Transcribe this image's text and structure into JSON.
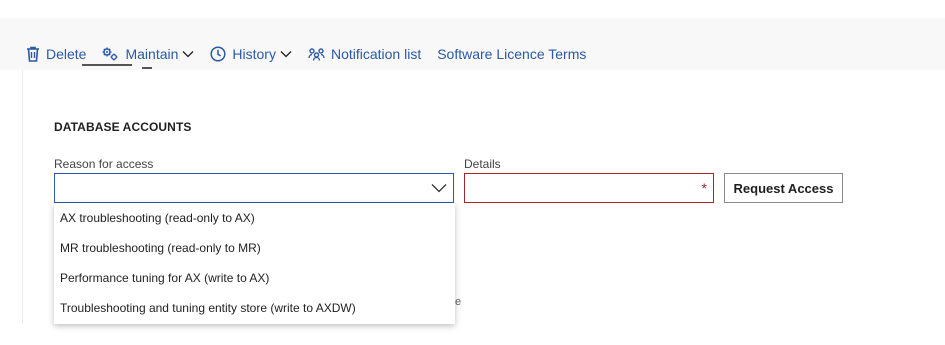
{
  "colors": {
    "accent": "#2b59a6",
    "error": "#a4262c"
  },
  "toolbar": {
    "items": [
      {
        "label": "Delete",
        "icon": "trash-icon"
      },
      {
        "label": "Maintain",
        "icon": "gears-icon",
        "has_menu": true
      },
      {
        "label": "History",
        "icon": "clock-icon",
        "has_menu": true
      },
      {
        "label": "Notification list",
        "icon": "people-network-icon"
      },
      {
        "label": "Software Licence Terms"
      }
    ]
  },
  "section": {
    "title": "DATABASE ACCOUNTS"
  },
  "form": {
    "reason_label": "Reason for access",
    "reason_value": "",
    "details_label": "Details",
    "details_value": "",
    "required_mark": "*",
    "request_button": "Request Access"
  },
  "dropdown": {
    "options": [
      "AX troubleshooting (read-only to AX)",
      "MR troubleshooting (read-only to MR)",
      "Performance tuning for AX (write to AX)",
      "Troubleshooting and tuning entity store (write to AXDW)"
    ]
  },
  "peek_text": "e"
}
